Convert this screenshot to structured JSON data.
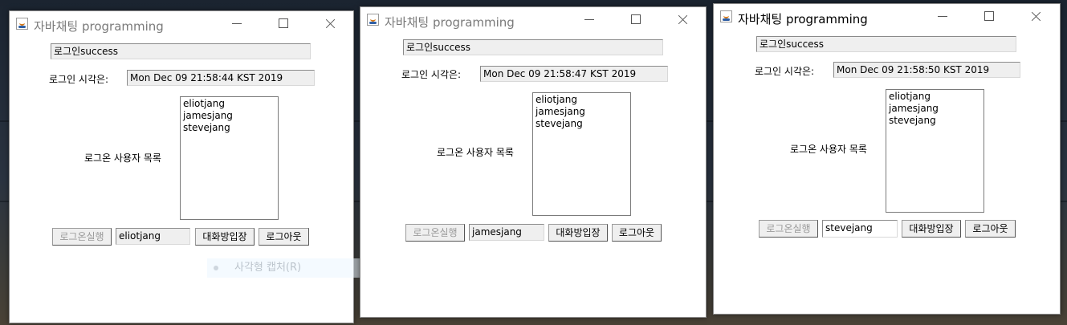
{
  "windows": [
    {
      "title": "자바채팅 programming",
      "status": "로그인success",
      "login_time_label": "로그인 시각은:",
      "login_time": "Mon Dec 09 21:58:44 KST 2019",
      "users_label": "로그온 사용자 목록",
      "users": [
        "eliotjang",
        "jamesjang",
        "stevejang"
      ],
      "login_button": "로그온실행",
      "username": "eliotjang",
      "enter_room_button": "대화방입장",
      "logout_button": "로그아웃"
    },
    {
      "title": "자바채팅 programming",
      "status": "로그인success",
      "login_time_label": "로그인 시각은:",
      "login_time": "Mon Dec 09 21:58:47 KST 2019",
      "users_label": "로그온 사용자 목록",
      "users": [
        "eliotjang",
        "jamesjang",
        "stevejang"
      ],
      "login_button": "로그온실행",
      "username": "jamesjang",
      "enter_room_button": "대화방입장",
      "logout_button": "로그아웃"
    },
    {
      "title": "자바채팅 programming",
      "status": "로그인success",
      "login_time_label": "로그인 시각은:",
      "login_time": "Mon Dec 09 21:58:50 KST 2019",
      "users_label": "로그온 사용자 목록",
      "users": [
        "eliotjang",
        "jamesjang",
        "stevejang"
      ],
      "login_button": "로그온실행",
      "username": "stevejang",
      "enter_room_button": "대화방입장",
      "logout_button": "로그아웃"
    }
  ],
  "overlay": {
    "capture_menu_label": "사각형 캡처(R)"
  }
}
